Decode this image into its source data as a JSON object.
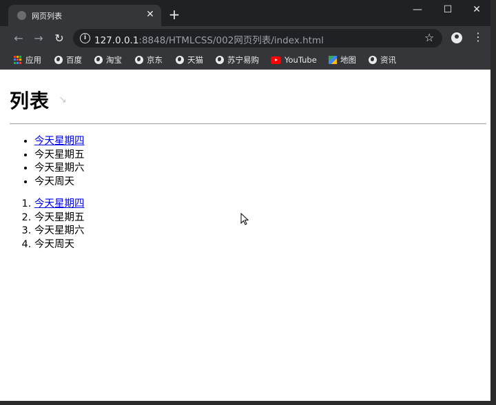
{
  "browser": {
    "tab": {
      "title": "网页列表",
      "close_glyph": "✕",
      "new_tab_glyph": "+"
    },
    "window_controls": {
      "minimize": "—",
      "maximize": "☐",
      "close": "✕"
    },
    "toolbar": {
      "back_glyph": "←",
      "forward_glyph": "→",
      "reload_glyph": "↻",
      "url_host": "127.0.0.1",
      "url_rest": ":8848/HTMLCSS/002网页列表/index.html",
      "star_glyph": "☆",
      "menu_glyph": "⋮"
    },
    "bookmarks": [
      {
        "label": "应用",
        "icon": "apps-icon"
      },
      {
        "label": "百度",
        "icon": "globe-icon"
      },
      {
        "label": "淘宝",
        "icon": "globe-icon"
      },
      {
        "label": "京东",
        "icon": "globe-icon"
      },
      {
        "label": "天猫",
        "icon": "globe-icon"
      },
      {
        "label": "苏宁易购",
        "icon": "globe-icon"
      },
      {
        "label": "YouTube",
        "icon": "youtube-icon"
      },
      {
        "label": "地图",
        "icon": "maps-icon"
      },
      {
        "label": "资讯",
        "icon": "globe-icon"
      }
    ]
  },
  "page": {
    "title": "列表",
    "title_icon": "↘",
    "unordered_list": [
      "今天星期四",
      "今天星期五",
      "今天星期六",
      "今天周天"
    ],
    "ordered_list": [
      "今天星期四",
      "今天星期五",
      "今天星期六",
      "今天周天"
    ]
  },
  "colors": {
    "tabbar_bg": "#202124",
    "toolbar_bg": "#35363a",
    "link": "#0000ee"
  }
}
